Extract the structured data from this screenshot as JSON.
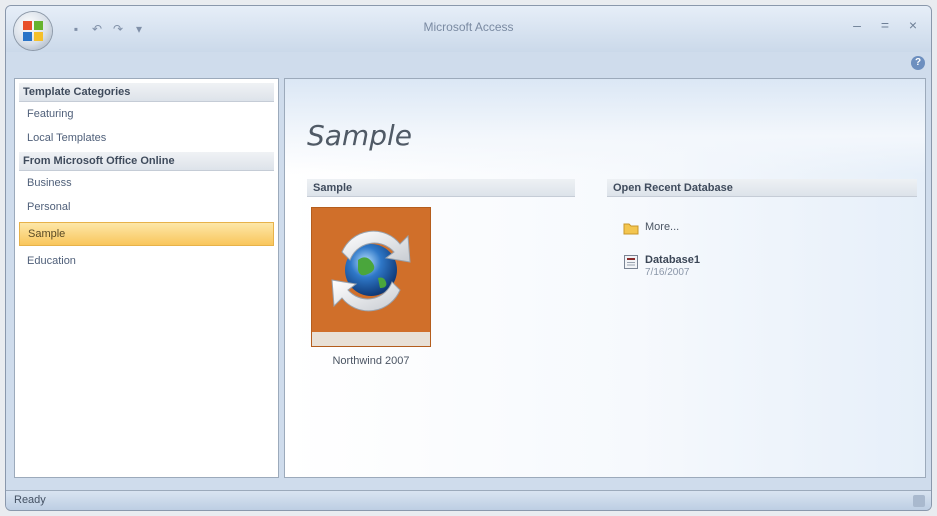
{
  "window": {
    "title": "Microsoft Access",
    "minimize_glyph": "–",
    "restore_glyph": "=",
    "close_glyph": "×",
    "help_glyph": "?"
  },
  "quick_access": [
    "save-icon",
    "undo-icon",
    "redo-icon",
    "customize-icon"
  ],
  "sidebar": {
    "header1": "Template Categories",
    "header2": "From Microsoft Office Online",
    "items_local": [
      {
        "label": "Featuring"
      },
      {
        "label": "Local Templates"
      }
    ],
    "items_online": [
      {
        "label": "Business"
      },
      {
        "label": "Personal"
      },
      {
        "label": "Sample",
        "selected": true
      },
      {
        "label": "Education"
      }
    ]
  },
  "main": {
    "page_title": "Sample",
    "sample_section_header": "Sample",
    "recent_section_header": "Open Recent Database",
    "templates": [
      {
        "label": "Northwind 2007",
        "icon": "northwind-icon"
      }
    ],
    "recent": [
      {
        "label": "More...",
        "icon": "folder-icon"
      },
      {
        "label": "Database1",
        "date": "7/16/2007",
        "icon": "database-icon"
      }
    ]
  },
  "status": {
    "text": "Ready"
  },
  "colors": {
    "accent_selected": "#f9c65c",
    "tile_orange": "#d06f2a"
  }
}
